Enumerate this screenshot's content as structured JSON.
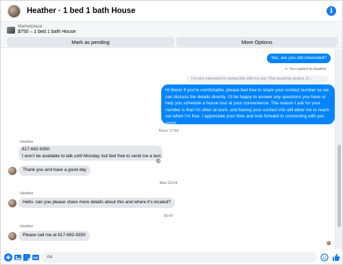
{
  "header": {
    "title": "Heather · 1 bed 1 bath House"
  },
  "marketplace": {
    "label": "Marketplace",
    "listing": "$750 – 1 bed 1 bath House",
    "mark_pending_label": "Mark as pending",
    "more_options_label": "More Options"
  },
  "messages": {
    "out1": "Yes, are you still interested?",
    "replied_note": "You replied to Heather",
    "reply_preview": "I'm very interested in seeing this with my son. This would be perfect. D...",
    "out2": "Hi there! If you're comfortable, please feel free to share your contact number so we can discuss the details directly. I'd be happy to answer any questions you have or help you schedule a house tour at your convenience. The reason I ask for your number is that I'm often at work, and having your contact info will allow me to reach out when I'm free. I appreciate your time and look forward to connecting with you soon!",
    "stamp1": "Thurs 17:53",
    "sender1": "Heather",
    "in1_line1": "817-692-9350",
    "in1_line2": "I won't be available to talk until Monday, but feel free to send me a text.",
    "in1_reaction": "😮",
    "in2": "Thank you and have a good day",
    "stamp2": "Mon 23:04",
    "sender2": "Heather",
    "in3": "Hello- can you please share more details about this and where it's located?",
    "stamp3": "00:47",
    "sender3": "Heather",
    "in4": "Please call me at 817-692-9350"
  },
  "composer": {
    "placeholder": "Aa"
  },
  "colors": {
    "accent": "#0084ff",
    "brand": "#1877f2",
    "incoming": "#e4e6eb"
  },
  "icons": [
    "info-icon",
    "plus-icon",
    "photo-icon",
    "sticker-icon",
    "gif-icon",
    "emoji-icon",
    "like-icon"
  ]
}
